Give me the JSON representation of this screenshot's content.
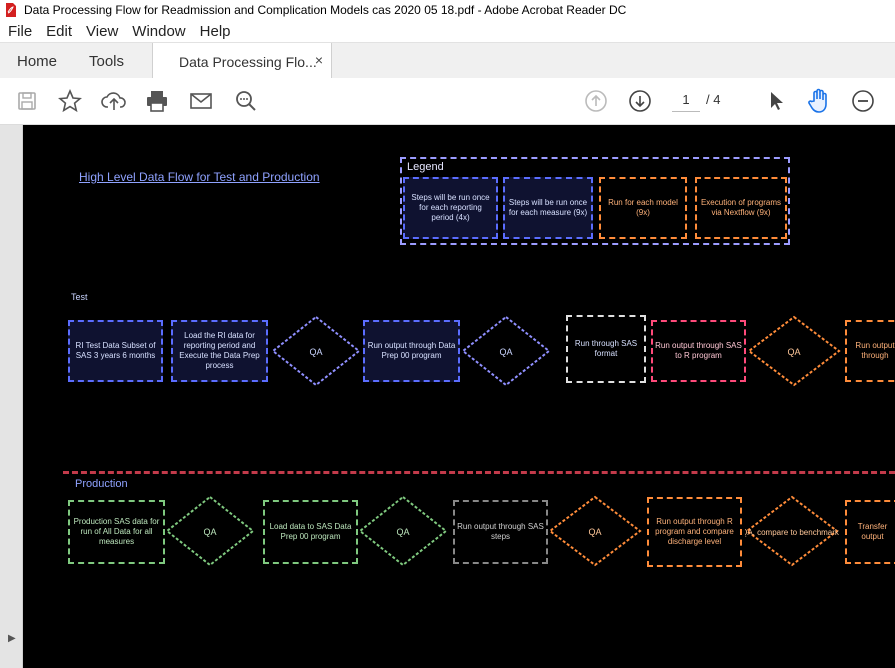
{
  "window": {
    "title": "Data Processing Flow for Readmission and Complication Models cas 2020 05 18.pdf - Adobe Acrobat Reader DC"
  },
  "menu": {
    "items": [
      "File",
      "Edit",
      "View",
      "Window",
      "Help"
    ]
  },
  "tabs": {
    "home": "Home",
    "tools": "Tools",
    "document": "Data Processing Flo...",
    "close": "×"
  },
  "toolbar": {
    "page_current": "1",
    "page_total": "/ 4"
  },
  "document": {
    "heading": "High Level Data Flow for Test and Production",
    "legend_title": "Legend",
    "legend_items": [
      "Steps will be run once for each reporting period (4x)",
      "Steps will be run once for each measure (9x)",
      "Run for each model (9x)",
      "Execution of programs via Nextflow (9x)"
    ],
    "test_label": "Test",
    "production_label": "Production",
    "test_steps": [
      "RI Test Data Subset of SAS 3 years 6 months",
      "Load the RI data for reporting period and Execute the Data Prep process",
      "QA",
      "Run output through Data Prep 00 program",
      "QA",
      "Run through SAS format",
      "Run output through SAS to R program",
      "QA",
      "Run output through"
    ],
    "production_steps": [
      "Production SAS data for run of All Data for all measures",
      "QA",
      "Load data to SAS Data Prep 00 program",
      "QA",
      "Run output through SAS steps",
      "QA",
      "Run output through R program and compare discharge level",
      "QA, compare to benchmarks",
      "Transfer output"
    ]
  }
}
